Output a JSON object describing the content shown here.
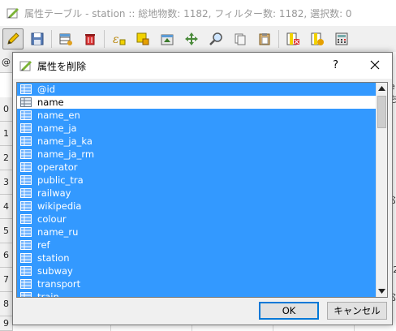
{
  "main_window": {
    "title": "属性テーブル - station :: 総地物数: 1182, フィルター数: 1182, 選択数: 0",
    "toolbar_icons": [
      "pencil-icon",
      "save-icon",
      "table-edit-icon",
      "delete-icon",
      "expression-icon",
      "select-icon",
      "move-top-icon",
      "filter-icon",
      "zoom-icon",
      "copy-icon",
      "paste-icon",
      "delete-column-icon",
      "new-column-icon",
      "field-calculator-icon"
    ]
  },
  "table": {
    "row_headers": [
      "0",
      "1",
      "2",
      "3",
      "4",
      "5",
      "6",
      "7",
      "8",
      "9"
    ],
    "header_prefix": "@",
    "side_glyphs": [
      "e",
      "ち",
      "ぶ",
      "(2",
      "ふ",
      "(2",
      "ふ",
      "(2",
      "ふ",
      "(2"
    ]
  },
  "dialog": {
    "title": "属性を削除",
    "help": "?",
    "fields": [
      {
        "label": "@id",
        "selected": true
      },
      {
        "label": "name",
        "selected": false
      },
      {
        "label": "name_en",
        "selected": true
      },
      {
        "label": "name_ja",
        "selected": true
      },
      {
        "label": "name_ja_ka",
        "selected": true
      },
      {
        "label": "name_ja_rm",
        "selected": true
      },
      {
        "label": "operator",
        "selected": true
      },
      {
        "label": "public_tra",
        "selected": true
      },
      {
        "label": "railway",
        "selected": true
      },
      {
        "label": "wikipedia",
        "selected": true
      },
      {
        "label": "colour",
        "selected": true
      },
      {
        "label": "name_ru",
        "selected": true
      },
      {
        "label": "ref",
        "selected": true
      },
      {
        "label": "station",
        "selected": true
      },
      {
        "label": "subway",
        "selected": true
      },
      {
        "label": "transport",
        "selected": true
      },
      {
        "label": "train",
        "selected": true
      }
    ],
    "ok_label": "OK",
    "cancel_label": "キャンセル"
  },
  "colors": {
    "selection": "#3399ff",
    "dialog_bg": "#f0f0f0"
  }
}
